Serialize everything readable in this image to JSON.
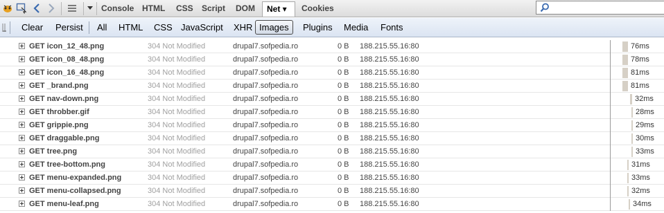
{
  "toolbar": {
    "tabs": [
      {
        "label": "Console"
      },
      {
        "label": "HTML"
      },
      {
        "label": "CSS"
      },
      {
        "label": "Script"
      },
      {
        "label": "DOM"
      },
      {
        "label": "Net ▾"
      },
      {
        "label": "Cookies"
      }
    ],
    "search": {
      "value": "",
      "icon": "search-icon"
    }
  },
  "filterbar": {
    "items": [
      "Clear",
      "Persist",
      "All",
      "HTML",
      "CSS",
      "JavaScript",
      "XHR",
      "Images",
      "Plugins",
      "Media",
      "Fonts"
    ],
    "active": "Images"
  },
  "requests": [
    {
      "url": "GET icon_12_48.png",
      "status": "304 Not Modified",
      "domain": "drupal7.sofpedia.ro",
      "size": "0 B",
      "ip": "188.215.55.16:80",
      "time": "76ms"
    },
    {
      "url": "GET icon_08_48.png",
      "status": "304 Not Modified",
      "domain": "drupal7.sofpedia.ro",
      "size": "0 B",
      "ip": "188.215.55.16:80",
      "time": "78ms"
    },
    {
      "url": "GET icon_16_48.png",
      "status": "304 Not Modified",
      "domain": "drupal7.sofpedia.ro",
      "size": "0 B",
      "ip": "188.215.55.16:80",
      "time": "81ms"
    },
    {
      "url": "GET _brand.png",
      "status": "304 Not Modified",
      "domain": "drupal7.sofpedia.ro",
      "size": "0 B",
      "ip": "188.215.55.16:80",
      "time": "81ms"
    },
    {
      "url": "GET nav-down.png",
      "status": "304 Not Modified",
      "domain": "drupal7.sofpedia.ro",
      "size": "0 B",
      "ip": "188.215.55.16:80",
      "time": "32ms"
    },
    {
      "url": "GET throbber.gif",
      "status": "304 Not Modified",
      "domain": "drupal7.sofpedia.ro",
      "size": "0 B",
      "ip": "188.215.55.16:80",
      "time": "28ms"
    },
    {
      "url": "GET grippie.png",
      "status": "304 Not Modified",
      "domain": "drupal7.sofpedia.ro",
      "size": "0 B",
      "ip": "188.215.55.16:80",
      "time": "29ms"
    },
    {
      "url": "GET draggable.png",
      "status": "304 Not Modified",
      "domain": "drupal7.sofpedia.ro",
      "size": "0 B",
      "ip": "188.215.55.16:80",
      "time": "30ms"
    },
    {
      "url": "GET tree.png",
      "status": "304 Not Modified",
      "domain": "drupal7.sofpedia.ro",
      "size": "0 B",
      "ip": "188.215.55.16:80",
      "time": "33ms"
    },
    {
      "url": "GET tree-bottom.png",
      "status": "304 Not Modified",
      "domain": "drupal7.sofpedia.ro",
      "size": "0 B",
      "ip": "188.215.55.16:80",
      "time": "31ms"
    },
    {
      "url": "GET menu-expanded.png",
      "status": "304 Not Modified",
      "domain": "drupal7.sofpedia.ro",
      "size": "0 B",
      "ip": "188.215.55.16:80",
      "time": "33ms"
    },
    {
      "url": "GET menu-collapsed.png",
      "status": "304 Not Modified",
      "domain": "drupal7.sofpedia.ro",
      "size": "0 B",
      "ip": "188.215.55.16:80",
      "time": "32ms"
    },
    {
      "url": "GET menu-leaf.png",
      "status": "304 Not Modified",
      "domain": "drupal7.sofpedia.ro",
      "size": "0 B",
      "ip": "188.215.55.16:80",
      "time": "34ms"
    }
  ]
}
